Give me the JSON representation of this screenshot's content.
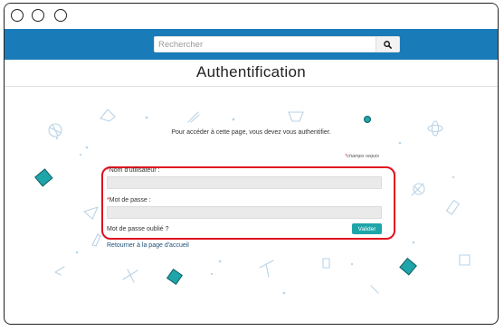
{
  "window": {
    "controls": [
      "close",
      "minimize",
      "maximize"
    ]
  },
  "header": {
    "search_placeholder": "Rechercher",
    "search_icon": "search-icon",
    "brand_color": "#1a7bb9"
  },
  "page": {
    "title": "Authentification",
    "intro": "Pour accéder à cette page, vous devez vous authentifier.",
    "required_star": "*",
    "required_note": "champs requis"
  },
  "form": {
    "username_star": "*",
    "username_label": "Nom d'utilisateur :",
    "username_value": "",
    "password_star": "*",
    "password_label": "Mot de passe :",
    "password_value": "",
    "forgot_link": "Mot de passe oublié ?",
    "submit_label": "Valider",
    "submit_color": "#1ea5a9",
    "highlight_color": "#e0121f"
  },
  "footer_link": "Retourner à la page d'accueil"
}
